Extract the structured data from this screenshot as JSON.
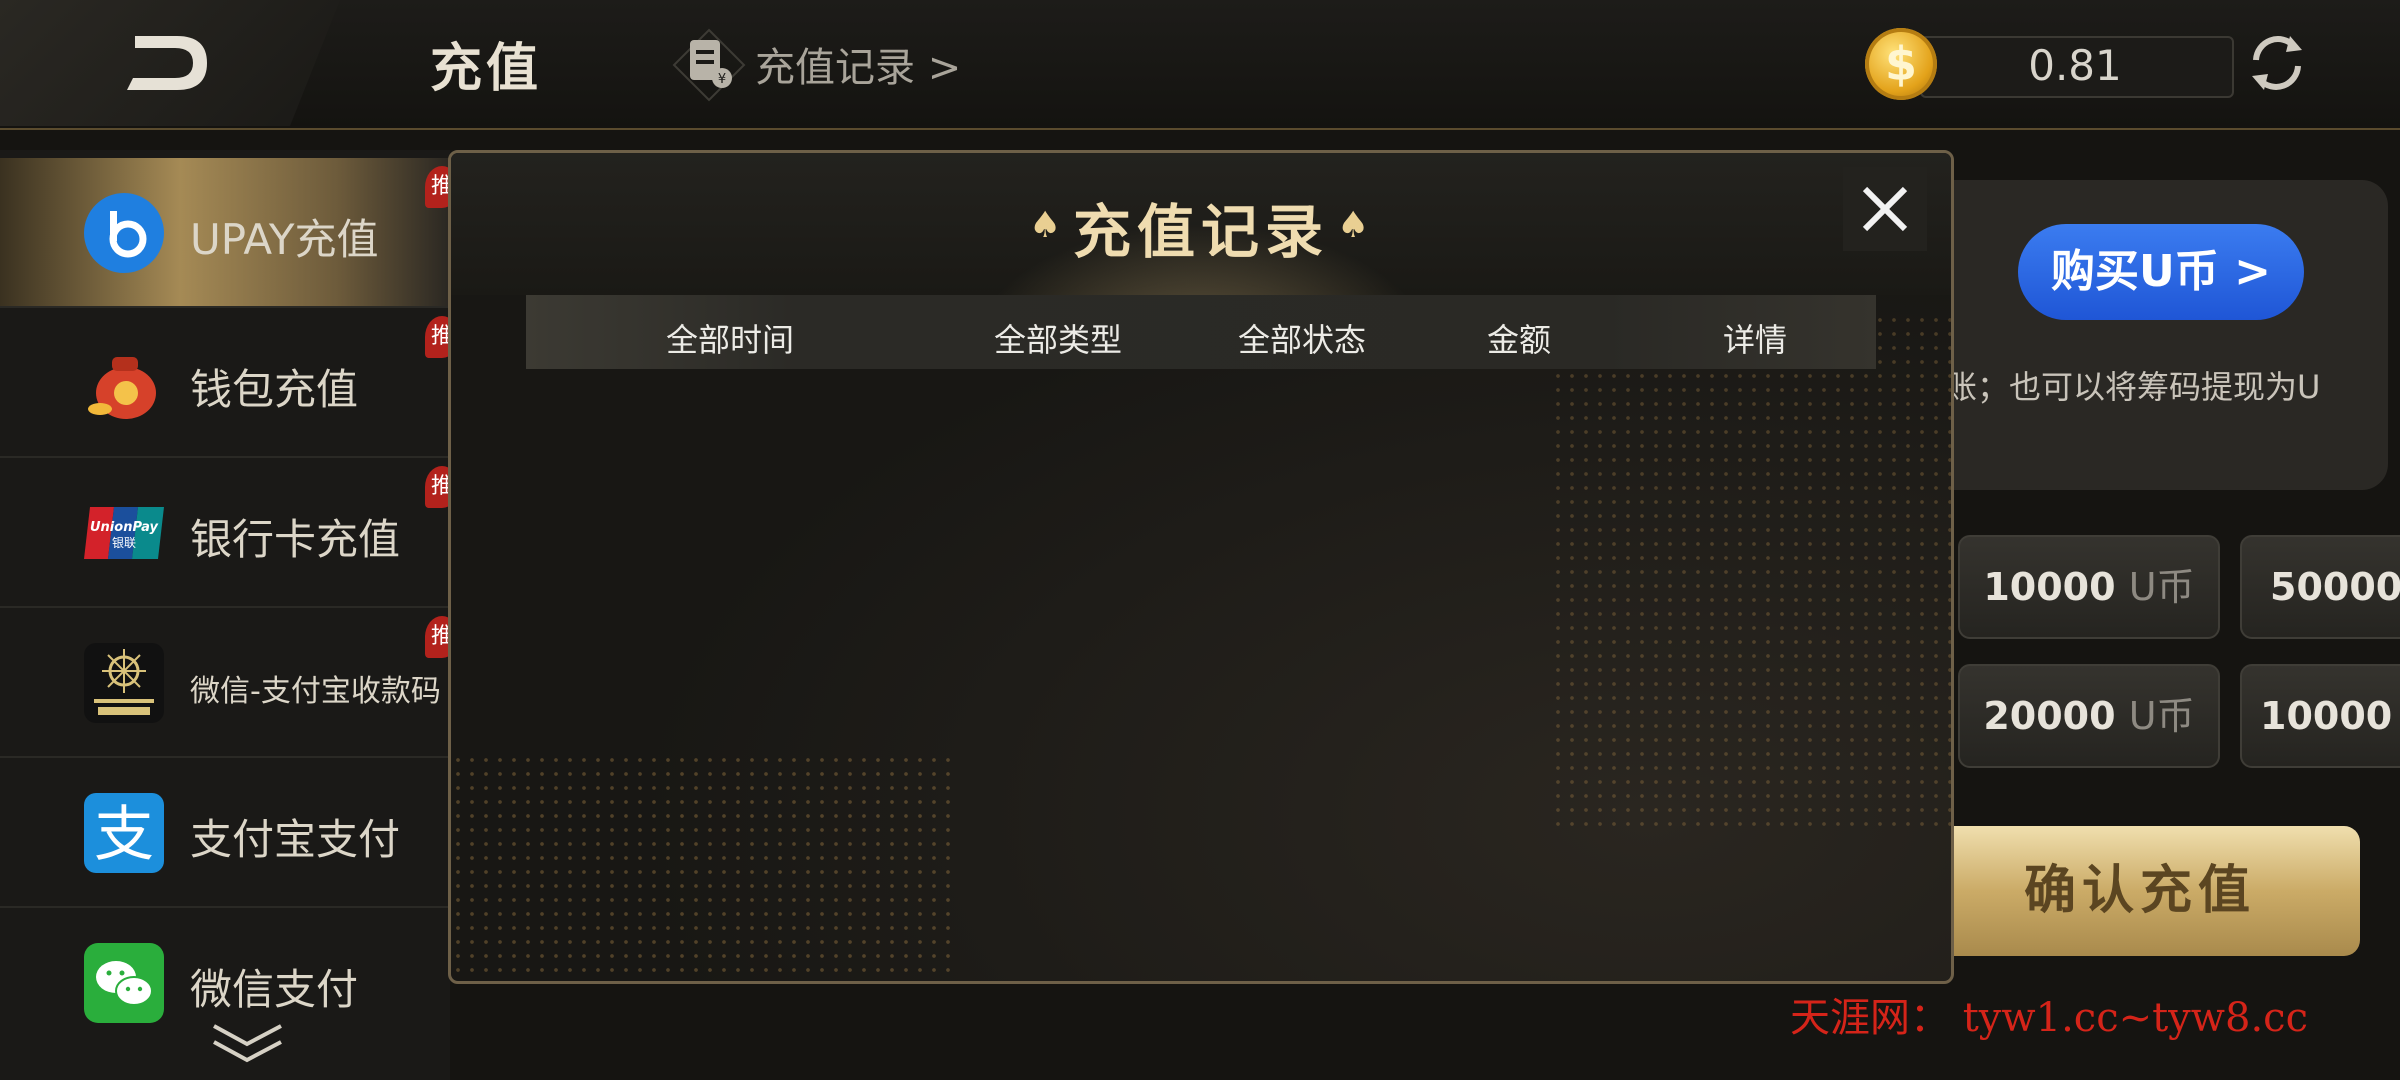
{
  "header": {
    "title": "充值",
    "record_link": "充值记录 >",
    "coin_symbol": "$",
    "balance": "0.81"
  },
  "sidebar": {
    "items": [
      {
        "label": "UPAY充值",
        "badge": "推",
        "active": true
      },
      {
        "label": "钱包充值",
        "badge": "推"
      },
      {
        "label": "银行卡充值",
        "badge": "推"
      },
      {
        "label": "微信-支付宝收款码",
        "badge": "推"
      },
      {
        "label": "支付宝支付"
      },
      {
        "label": "微信支付"
      }
    ],
    "unionpay_text": "UnionPay",
    "unionpay_cn": "银联"
  },
  "main": {
    "buy_button": "购买U币 >",
    "description": "账；也可以将筹码提现为U",
    "amounts": [
      {
        "value": "10000",
        "unit": "U币"
      },
      {
        "value": "50000",
        "unit": ""
      },
      {
        "value": "20000",
        "unit": "U币"
      },
      {
        "value": "10000",
        "unit": ""
      }
    ],
    "confirm_button": "确认充值"
  },
  "modal": {
    "title": "充值记录",
    "columns": [
      "全部时间",
      "全部类型",
      "全部状态",
      "金额",
      "详情"
    ]
  },
  "watermark": "天涯网： tyw1.cc~tyw8.cc",
  "colors": {
    "accent_gold": "#cbab67",
    "buy_blue": "#2563e0",
    "badge_red": "#b3221c",
    "watermark_red": "#d52419"
  }
}
